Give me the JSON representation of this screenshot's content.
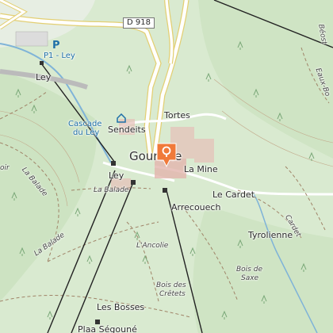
{
  "map": {
    "road_label": "D 918",
    "places": {
      "gourette": "Gourette",
      "tortes": "Tortes",
      "sendeits": "Sendeits",
      "la_mine": "La Mine",
      "le_cardet": "Le Cardet",
      "arrecouech": "Arrecouech",
      "tyrolienne": "Tyrolienne",
      "ley_top": "Ley",
      "ley_mid": "Ley",
      "les_bosses": "Les Bosses",
      "plaa_segoune": "Plaa Ségouné"
    },
    "parking": "P1 - Ley",
    "waterfall": [
      "Cascade",
      "du Ley"
    ],
    "trails": {
      "la_balade_left": "La Balade",
      "la_balade_mid": "La Balade",
      "la_balade_low": "La Balade",
      "ancolie": "L'Ancolie",
      "cardet": "Cardet",
      "eaux_bonnes": "Eaux-Bo",
      "beost": "Béost"
    },
    "woods": {
      "cretets": [
        "Bois des",
        "Crêtets"
      ],
      "saxe": [
        "Bois de",
        "Saxe"
      ],
      "left_edge": "oir"
    },
    "icons": [
      "parking-icon",
      "location-pin-icon",
      "hut-icon",
      "tree-icon"
    ],
    "colors": {
      "meadow": "#d9ead0",
      "forest": "#cde3c2",
      "road": "#ffffff",
      "road_casing": "#e3cf73",
      "pin": "#f07a3a",
      "water": "#7fb3d8"
    }
  }
}
